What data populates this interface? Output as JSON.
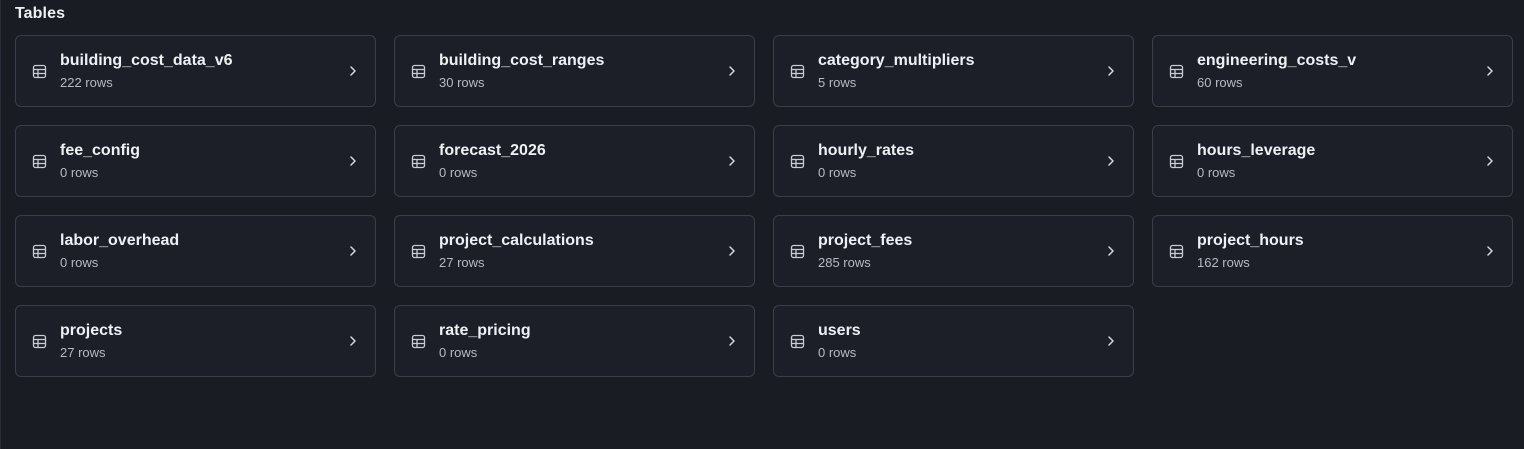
{
  "section": {
    "title": "Tables"
  },
  "icons": {
    "table": "table-icon",
    "chevron": "chevron-right-icon"
  },
  "colors": {
    "background": "#1a1c24",
    "card_background": "#1c1f27",
    "card_border": "#3a3e4a",
    "text_primary": "#eef0f4",
    "text_secondary": "#b7bac3"
  },
  "tables": [
    {
      "name": "building_cost_data_v6",
      "rows": "222 rows"
    },
    {
      "name": "building_cost_ranges",
      "rows": "30 rows"
    },
    {
      "name": "category_multipliers",
      "rows": "5 rows"
    },
    {
      "name": "engineering_costs_v",
      "rows": "60 rows"
    },
    {
      "name": "fee_config",
      "rows": "0 rows"
    },
    {
      "name": "forecast_2026",
      "rows": "0 rows"
    },
    {
      "name": "hourly_rates",
      "rows": "0 rows"
    },
    {
      "name": "hours_leverage",
      "rows": "0 rows"
    },
    {
      "name": "labor_overhead",
      "rows": "0 rows"
    },
    {
      "name": "project_calculations",
      "rows": "27 rows"
    },
    {
      "name": "project_fees",
      "rows": "285 rows"
    },
    {
      "name": "project_hours",
      "rows": "162 rows"
    },
    {
      "name": "projects",
      "rows": "27 rows"
    },
    {
      "name": "rate_pricing",
      "rows": "0 rows"
    },
    {
      "name": "users",
      "rows": "0 rows"
    }
  ]
}
